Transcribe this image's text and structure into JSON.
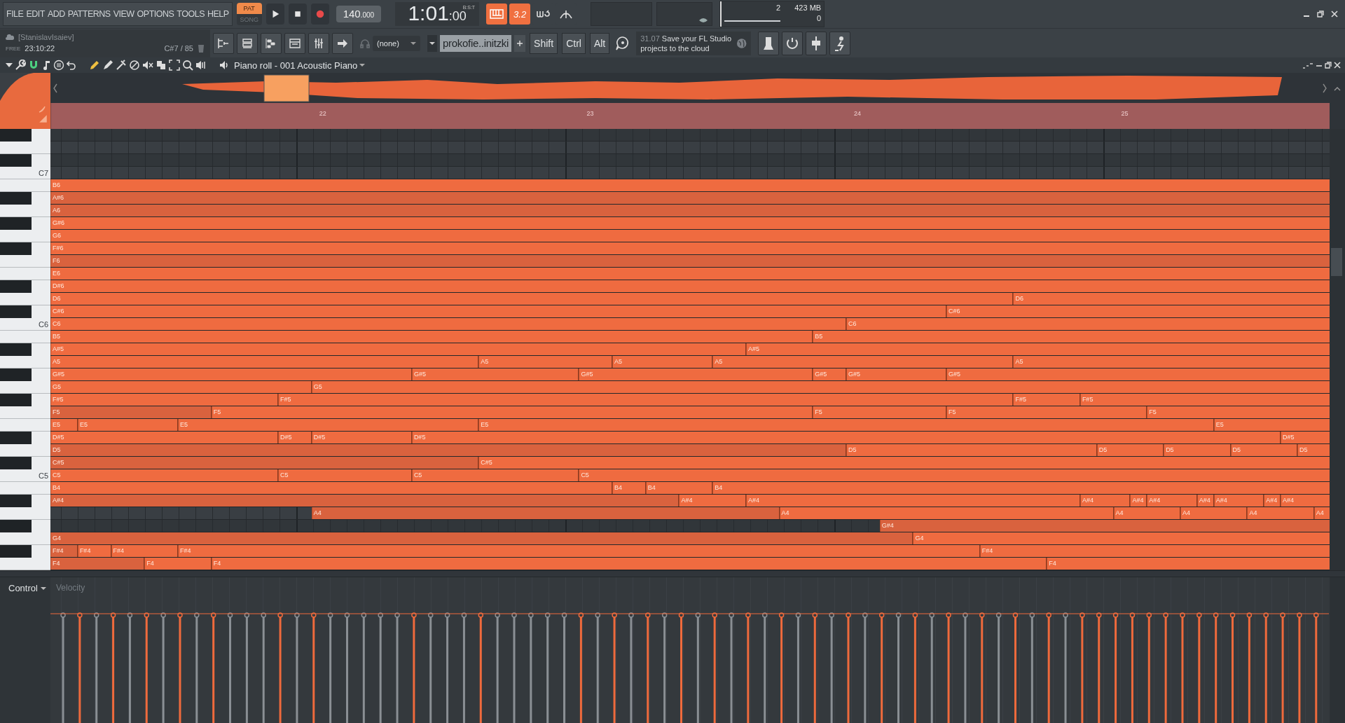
{
  "menu": [
    "FILE",
    "EDIT",
    "ADD",
    "PATTERNS",
    "VIEW",
    "OPTIONS",
    "TOOLS",
    "HELP"
  ],
  "transport": {
    "modes": [
      {
        "label": "PAT",
        "selected": true
      },
      {
        "label": "SONG",
        "selected": false
      }
    ],
    "tempo": "140",
    "tempo_fraction": ".000",
    "time": "1:01",
    "time_ticks": ":00",
    "time_format": "B:S:T"
  },
  "toggles": [
    {
      "kind": "keyboard",
      "selected": true
    },
    {
      "kind": "counter",
      "label": "3.2",
      "selected": true
    },
    {
      "kind": "loop",
      "selected": false
    },
    {
      "kind": "metronome",
      "selected": false
    }
  ],
  "monitor": {
    "cpu": "2",
    "memory": "423 MB",
    "polyphony": "0"
  },
  "info": {
    "user": "[StanislavIsaiev]",
    "tag": "FREE",
    "clock": "23:10:22",
    "note": "C#7 / 85"
  },
  "channel": "(none)",
  "pattern": "prokofie..initzki",
  "modifiers": [
    "Shift",
    "Ctrl",
    "Alt"
  ],
  "news": {
    "date": "31.07",
    "text": "Save your FL Studio projects to the cloud"
  },
  "piano_roll": {
    "title": "Piano roll - 001 Acoustic Piano",
    "ruler": [
      "22",
      "23",
      "24",
      "25"
    ],
    "rows": [
      {
        "kind": "black"
      },
      {
        "kind": "white"
      },
      {
        "kind": "black"
      },
      {
        "kind": "white",
        "key_label": "C7"
      },
      {
        "kind": "white",
        "notes": [
          {
            "label": "B6",
            "dim": false
          }
        ]
      },
      {
        "kind": "black",
        "notes": [
          {
            "label": "A#6",
            "dim": true
          }
        ]
      },
      {
        "kind": "white",
        "notes": [
          {
            "label": "A6",
            "dim": true
          }
        ]
      },
      {
        "kind": "black",
        "notes": [
          {
            "label": "G#6",
            "dim": false
          }
        ]
      },
      {
        "kind": "white",
        "notes": [
          {
            "label": "G6",
            "dim": false
          }
        ]
      },
      {
        "kind": "black",
        "notes": [
          {
            "label": "F#6",
            "dim": false
          }
        ]
      },
      {
        "kind": "white",
        "notes": [
          {
            "label": "F6",
            "dim": true
          }
        ]
      },
      {
        "kind": "white",
        "notes": [
          {
            "label": "E6",
            "dim": false
          }
        ]
      },
      {
        "kind": "black",
        "notes": [
          {
            "label": "D#6",
            "dim": false
          }
        ]
      },
      {
        "kind": "white",
        "notes": [
          {
            "label": "D6",
            "dim": false
          },
          {
            "label": "D6",
            "dim": false
          }
        ]
      },
      {
        "kind": "black",
        "notes": [
          {
            "label": "C#6",
            "dim": false
          },
          {
            "label": "C#6",
            "dim": false
          }
        ]
      },
      {
        "kind": "white",
        "key_label": "C6",
        "notes": [
          {
            "label": "C6",
            "dim": false
          },
          {
            "label": "C6",
            "dim": false
          }
        ]
      },
      {
        "kind": "white",
        "notes": [
          {
            "label": "B5",
            "dim": false
          },
          {
            "label": "B5",
            "dim": false
          }
        ]
      },
      {
        "kind": "black",
        "notes": [
          {
            "label": "A#5",
            "dim": false
          },
          {
            "label": "A#5",
            "dim": false
          }
        ]
      },
      {
        "kind": "white",
        "notes": [
          {
            "label": "A5",
            "dim": false
          },
          {
            "label": "A5",
            "dim": false
          },
          {
            "label": "A5",
            "dim": false
          },
          {
            "label": "A5",
            "dim": false
          },
          {
            "label": "A5",
            "dim": false
          }
        ]
      },
      {
        "kind": "black",
        "notes": [
          {
            "label": "G#5",
            "dim": false
          },
          {
            "label": "G#5",
            "dim": false
          },
          {
            "label": "G#5",
            "dim": false
          },
          {
            "label": "G#5",
            "dim": false
          },
          {
            "label": "G#5",
            "dim": false
          },
          {
            "label": "G#5",
            "dim": false
          }
        ]
      },
      {
        "kind": "white",
        "notes": [
          {
            "label": "G5",
            "dim": false
          },
          {
            "label": "G5",
            "dim": false
          }
        ]
      },
      {
        "kind": "black",
        "notes": [
          {
            "label": "F#5",
            "dim": false
          },
          {
            "label": "F#5",
            "dim": false
          },
          {
            "label": "F#5",
            "dim": false
          },
          {
            "label": "F#5",
            "dim": false
          }
        ]
      },
      {
        "kind": "white",
        "notes": [
          {
            "label": "F5",
            "dim": true
          },
          {
            "label": "F5",
            "dim": false
          },
          {
            "label": "F5",
            "dim": false
          },
          {
            "label": "F5",
            "dim": false
          },
          {
            "label": "F5",
            "dim": false
          }
        ]
      },
      {
        "kind": "white",
        "notes": [
          {
            "label": "E5",
            "dim": false
          },
          {
            "label": "E5",
            "dim": false
          },
          {
            "label": "E5",
            "dim": false
          },
          {
            "label": "E5",
            "dim": false
          },
          {
            "label": "E5",
            "dim": false
          }
        ]
      },
      {
        "kind": "black",
        "notes": [
          {
            "label": "D#5",
            "dim": false
          },
          {
            "label": "D#5",
            "dim": false
          },
          {
            "label": "D#5",
            "dim": false
          },
          {
            "label": "D#5",
            "dim": false
          },
          {
            "label": "D#5",
            "dim": false
          }
        ]
      },
      {
        "kind": "white",
        "notes": [
          {
            "label": "D5",
            "dim": true
          },
          {
            "label": "D5",
            "dim": false
          },
          {
            "label": "D5",
            "dim": false
          },
          {
            "label": "D5",
            "dim": false
          },
          {
            "label": "D5",
            "dim": false
          },
          {
            "label": "D5",
            "dim": false
          }
        ]
      },
      {
        "kind": "black",
        "notes": [
          {
            "label": "C#5",
            "dim": true
          },
          {
            "label": "C#5",
            "dim": false
          }
        ]
      },
      {
        "kind": "white",
        "key_label": "C5",
        "notes": [
          {
            "label": "C5",
            "dim": false
          },
          {
            "label": "C5",
            "dim": false
          },
          {
            "label": "C5",
            "dim": false
          },
          {
            "label": "C5",
            "dim": false
          }
        ]
      },
      {
        "kind": "white",
        "notes": [
          {
            "label": "B4",
            "dim": false
          },
          {
            "label": "B4",
            "dim": false
          },
          {
            "label": "B4",
            "dim": false
          },
          {
            "label": "B4",
            "dim": false
          }
        ]
      },
      {
        "kind": "black",
        "notes": [
          {
            "label": "A#4",
            "dim": true
          },
          {
            "label": "A#4",
            "dim": false
          },
          {
            "label": "A#4",
            "dim": false
          },
          {
            "label": "A#4",
            "dim": false
          },
          {
            "label": "A#4",
            "dim": false
          },
          {
            "label": "A#4",
            "dim": false
          },
          {
            "label": "A#4",
            "dim": false
          },
          {
            "label": "A#4",
            "dim": false
          },
          {
            "label": "A#4",
            "dim": false
          },
          {
            "label": "A#4",
            "dim": false
          }
        ]
      },
      {
        "kind": "white",
        "notes": [
          {
            "label": "A4",
            "dim": true
          },
          {
            "label": "A4",
            "dim": false
          },
          {
            "label": "A4",
            "dim": false
          },
          {
            "label": "A4",
            "dim": false
          },
          {
            "label": "A4",
            "dim": false
          },
          {
            "label": "A4",
            "dim": false
          }
        ]
      },
      {
        "kind": "black",
        "notes": [
          {
            "label": "G#4",
            "dim": true
          }
        ]
      },
      {
        "kind": "white",
        "notes": [
          {
            "label": "G4",
            "dim": true
          },
          {
            "label": "G4",
            "dim": false
          }
        ]
      },
      {
        "kind": "black",
        "notes": [
          {
            "label": "F#4",
            "dim": true
          },
          {
            "label": "F#4",
            "dim": false
          },
          {
            "label": "F#4",
            "dim": false
          },
          {
            "label": "F#4",
            "dim": false
          },
          {
            "label": "F#4",
            "dim": false
          }
        ]
      },
      {
        "kind": "white",
        "notes": [
          {
            "label": "F4",
            "dim": true
          },
          {
            "label": "F4",
            "dim": false
          },
          {
            "label": "F4",
            "dim": false
          },
          {
            "label": "F4",
            "dim": false
          }
        ]
      }
    ]
  },
  "event_editor": {
    "control": "Control",
    "parameter": "Velocity"
  }
}
